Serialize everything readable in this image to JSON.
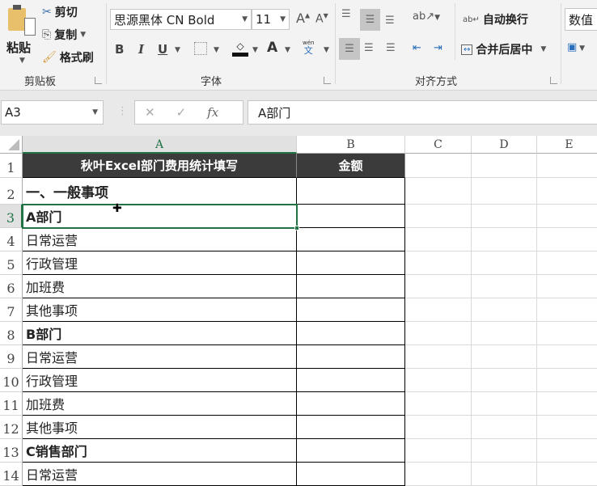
{
  "ribbon": {
    "clipboard": {
      "paste": "粘贴",
      "cut": "剪切",
      "copy": "复制",
      "format_painter": "格式刷",
      "group": "剪贴板"
    },
    "font": {
      "name": "思源黑体 CN Bold",
      "size": "11",
      "group": "字体",
      "bold": "B",
      "italic": "I",
      "underline": "U",
      "font_color": "A",
      "phonetic_top": "wén",
      "phonetic": "文"
    },
    "alignment": {
      "wrap_text": "自动换行",
      "merge_center": "合并后居中",
      "group": "对齐方式"
    },
    "number": {
      "format": "数值"
    }
  },
  "formula_bar": {
    "name_box": "A3",
    "fx": "fx",
    "content": "A部门"
  },
  "columns": [
    "A",
    "B",
    "C",
    "D",
    "E"
  ],
  "rows": [
    {
      "n": "1",
      "a": "秋叶Excel部门费用统计填写",
      "b": "金额"
    },
    {
      "n": "2",
      "a": "一、一般事项",
      "b": ""
    },
    {
      "n": "3",
      "a": "A部门",
      "b": ""
    },
    {
      "n": "4",
      "a": "日常运营",
      "b": ""
    },
    {
      "n": "5",
      "a": "行政管理",
      "b": ""
    },
    {
      "n": "6",
      "a": "加班费",
      "b": ""
    },
    {
      "n": "7",
      "a": "其他事项",
      "b": ""
    },
    {
      "n": "8",
      "a": "B部门",
      "b": ""
    },
    {
      "n": "9",
      "a": "日常运营",
      "b": ""
    },
    {
      "n": "10",
      "a": "行政管理",
      "b": ""
    },
    {
      "n": "11",
      "a": "加班费",
      "b": ""
    },
    {
      "n": "12",
      "a": "其他事项",
      "b": ""
    },
    {
      "n": "13",
      "a": "C销售部门",
      "b": ""
    },
    {
      "n": "14",
      "a": "日常运营",
      "b": ""
    }
  ],
  "selected_cell": "A3",
  "colors": {
    "selection": "#217346",
    "header_fill": "#3b3b3b"
  }
}
